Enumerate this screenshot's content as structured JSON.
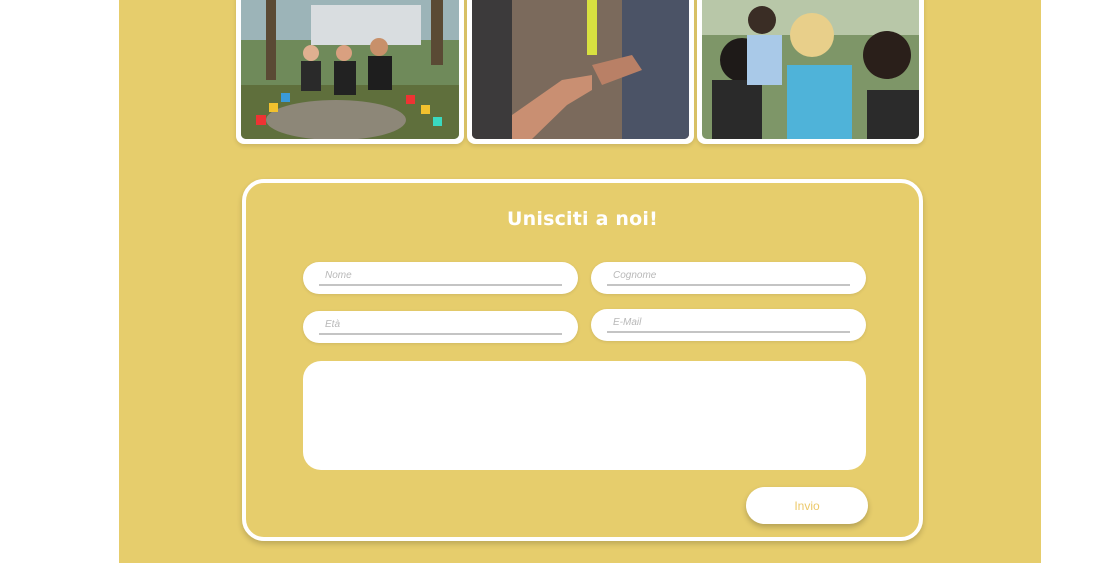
{
  "colors": {
    "background": "#e6cd6c",
    "card_border": "#ffffff",
    "button_text": "#ecc96a"
  },
  "photos": [
    {
      "name": "group-photo-park",
      "alt": ""
    },
    {
      "name": "hands-touching-photo",
      "alt": ""
    },
    {
      "name": "kids-activity-photo",
      "alt": ""
    }
  ],
  "form": {
    "title": "Unisciti a noi!",
    "fields": {
      "nome": {
        "placeholder": "Nome",
        "value": ""
      },
      "cognome": {
        "placeholder": "Cognome",
        "value": ""
      },
      "eta": {
        "placeholder": "Età",
        "value": ""
      },
      "email": {
        "placeholder": "E-Mail",
        "value": ""
      }
    },
    "message": {
      "value": ""
    },
    "submit_label": "Invio"
  }
}
